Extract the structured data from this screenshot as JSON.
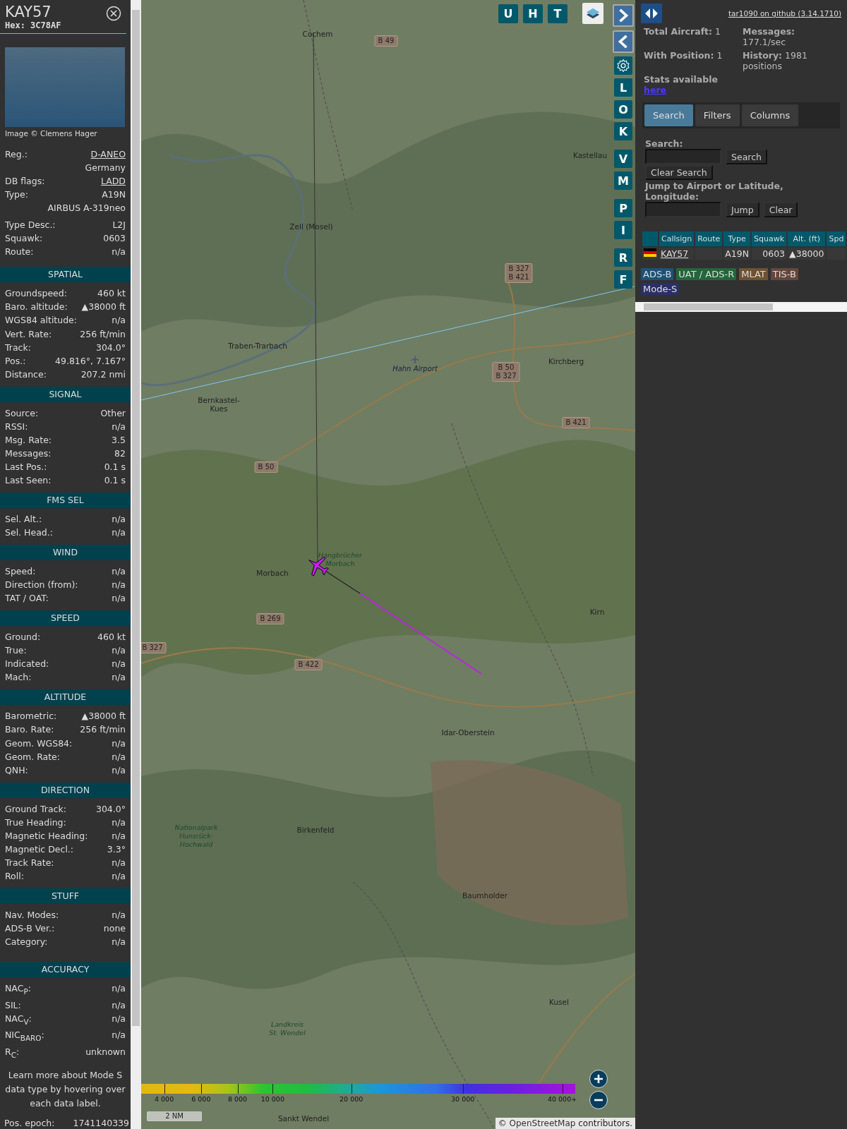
{
  "aircraft": {
    "callsign": "KAY57",
    "hex": "Hex: 3C78AF",
    "photo_credit": "Image © Clemens Hager",
    "details": [
      {
        "label": "Reg.:",
        "value": "D-ANEO",
        "kind": "link"
      },
      {
        "value": "Germany",
        "kind": "text"
      },
      {
        "label": "DB flags:",
        "value": "LADD",
        "kind": "link"
      },
      {
        "label": "Type:",
        "value": "A19N",
        "kind": "text"
      },
      {
        "value": "AIRBUS A-319neo",
        "kind": "text"
      },
      {
        "label": "Type Desc.:",
        "value": "L2J",
        "kind": "text"
      },
      {
        "label": "Squawk:",
        "value": "0603",
        "kind": "text"
      },
      {
        "label": "Route:",
        "value": "n/a",
        "kind": "text"
      }
    ],
    "sections": [
      {
        "title": "SPATIAL",
        "rows": [
          {
            "label": "Groundspeed:",
            "value": "460 kt"
          },
          {
            "label": "Baro. altitude:",
            "value": "▲38000 ft"
          },
          {
            "label": "WGS84 altitude:",
            "value": "n/a"
          },
          {
            "label": "Vert. Rate:",
            "value": "256 ft/min"
          },
          {
            "label": "Track:",
            "value": "304.0°"
          },
          {
            "label": "Pos.:",
            "value": "49.816°, 7.167°"
          },
          {
            "label": "Distance:",
            "value": "207.2 nmi"
          }
        ]
      },
      {
        "title": "SIGNAL",
        "rows": [
          {
            "label": "Source:",
            "value": "Other"
          },
          {
            "label": "RSSI:",
            "value": "n/a"
          },
          {
            "label": "Msg. Rate:",
            "value": "3.5"
          },
          {
            "label": "Messages:",
            "value": "82"
          },
          {
            "label": "Last Pos.:",
            "value": "0.1 s"
          },
          {
            "label": "Last Seen:",
            "value": "0.1 s"
          }
        ]
      },
      {
        "title": "FMS SEL",
        "rows": [
          {
            "label": "Sel. Alt.:",
            "value": "n/a"
          },
          {
            "label": "Sel. Head.:",
            "value": "n/a"
          }
        ]
      },
      {
        "title": "WIND",
        "rows": [
          {
            "label": "Speed:",
            "value": "n/a"
          },
          {
            "label": "Direction (from):",
            "value": "n/a"
          },
          {
            "label": "TAT / OAT:",
            "value": "n/a"
          }
        ]
      },
      {
        "title": "SPEED",
        "rows": [
          {
            "label": "Ground:",
            "value": "460 kt"
          },
          {
            "label": "True:",
            "value": "n/a"
          },
          {
            "label": "Indicated:",
            "value": "n/a"
          },
          {
            "label": "Mach:",
            "value": "n/a"
          }
        ]
      },
      {
        "title": "ALTITUDE",
        "rows": [
          {
            "label": "Barometric:",
            "value": "▲38000 ft"
          },
          {
            "label": "Baro. Rate:",
            "value": "256 ft/min"
          },
          {
            "label": "Geom. WGS84:",
            "value": "n/a"
          },
          {
            "label": "Geom. Rate:",
            "value": "n/a"
          },
          {
            "label": "QNH:",
            "value": "n/a"
          }
        ]
      },
      {
        "title": "DIRECTION",
        "rows": [
          {
            "label": "Ground Track:",
            "value": "304.0°"
          },
          {
            "label": "True Heading:",
            "value": "n/a"
          },
          {
            "label": "Magnetic Heading:",
            "value": "n/a"
          },
          {
            "label": "Magnetic Decl.:",
            "value": "3.3°"
          },
          {
            "label": "Track Rate:",
            "value": "n/a"
          },
          {
            "label": "Roll:",
            "value": "n/a"
          }
        ]
      },
      {
        "title": "STUFF",
        "rows": [
          {
            "label": "Nav. Modes:",
            "value": "n/a"
          },
          {
            "label": "ADS-B Ver.:",
            "value": "none"
          },
          {
            "label": "Category:",
            "value": "n/a"
          }
        ]
      },
      {
        "title": "ACCURACY",
        "rows": [
          {
            "label": "NAC$_{P}$:",
            "value": "n/a"
          },
          {
            "label": "SIL:",
            "value": "n/a"
          },
          {
            "label": "NAC$_{V}$:",
            "value": "n/a"
          },
          {
            "label": "NIC$_{BARO}$:",
            "value": "n/a"
          },
          {
            "label": "R$_{C}$:",
            "value": "unknown"
          }
        ]
      }
    ],
    "note": "Learn more about Mode S data type by hovering over each data label.",
    "epoch": {
      "label": "Pos. epoch:",
      "value": "1741140339"
    }
  },
  "map": {
    "top_buttons": [
      "U",
      "H",
      "T"
    ],
    "side_groups": [
      [
        "L",
        "O",
        "K"
      ],
      [
        "V",
        "M"
      ],
      [
        "P",
        "I"
      ],
      [
        "R",
        "F"
      ]
    ],
    "places": [
      {
        "name": "Cochem",
        "kind": "town"
      },
      {
        "name": "Kastellau",
        "kind": "town"
      },
      {
        "name": "Zell (Mosel)",
        "kind": "town"
      },
      {
        "name": "Traben-Trarbach",
        "kind": "town"
      },
      {
        "name": "Hahn Airport",
        "kind": "airport"
      },
      {
        "name": "Kirchberg",
        "kind": "town"
      },
      {
        "name": "Bernkastel-\nKues",
        "kind": "town"
      },
      {
        "name": "Hangbrücher\nMorbach",
        "kind": "park"
      },
      {
        "name": "Morbach",
        "kind": "town"
      },
      {
        "name": "Kirn",
        "kind": "town"
      },
      {
        "name": "Idar-Oberstein",
        "kind": "town"
      },
      {
        "name": "Nationalpark\nHunsrück-\nHochwald",
        "kind": "park"
      },
      {
        "name": "Birkenfeld",
        "kind": "town"
      },
      {
        "name": "Baumholder",
        "kind": "town"
      },
      {
        "name": "Kusel",
        "kind": "town"
      },
      {
        "name": "Landkreis\nSt. Wendel",
        "kind": "park"
      },
      {
        "name": "Sankt Wendel",
        "kind": "town"
      },
      {
        "name": "B 49",
        "kind": "road"
      },
      {
        "name": "B 327\nB 421",
        "kind": "road"
      },
      {
        "name": "B 50\nB 327",
        "kind": "road"
      },
      {
        "name": "B 421",
        "kind": "road"
      },
      {
        "name": "B 50",
        "kind": "road"
      },
      {
        "name": "B 269",
        "kind": "road"
      },
      {
        "name": "B 327",
        "kind": "road"
      },
      {
        "name": "B 422",
        "kind": "road"
      }
    ],
    "legend": [
      "4 000",
      "6 000",
      "8 000",
      "10 000",
      "20 000",
      "30 000",
      "40 000+"
    ],
    "scale": "2 NM",
    "attribution": {
      "prefix": "©",
      "link": "OpenStreetMap",
      "suffix": "contributors."
    }
  },
  "panel": {
    "github_link": "tar1090 on github (3.14.1710)",
    "stats": [
      {
        "label": "Total Aircraft:",
        "value": "1"
      },
      {
        "label": "Messages:",
        "value": "177.1/sec"
      },
      {
        "label": "With Position:",
        "value": "1"
      },
      {
        "label": "History:",
        "value": "1981 positions"
      }
    ],
    "stats_note": "Stats available",
    "stats_link": "here",
    "tabs": [
      {
        "label": "Search",
        "selected": true
      },
      {
        "label": "Filters",
        "selected": false
      },
      {
        "label": "Columns",
        "selected": false
      }
    ],
    "search_label": "Search:",
    "search_button": "Search",
    "clear_search_button": "Clear Search",
    "jump_label": "Jump to Airport or Latitude, Longitude:",
    "jump_button": "Jump",
    "clear_button": "Clear",
    "columns": [
      "Callsign",
      "Route",
      "Type",
      "Squawk",
      "Alt. (ft)",
      "Spd"
    ],
    "rows": [
      {
        "callsign": "KAY57",
        "type": "A19N",
        "squawk": "0603",
        "altitude": "▲38000"
      }
    ],
    "sources": [
      {
        "label": "ADS-B",
        "color": "#1d5275"
      },
      {
        "label": "UAT / ADS-R",
        "color": "#23663a"
      },
      {
        "label": "MLAT",
        "color": "#6e5232"
      },
      {
        "label": "TIS-B",
        "color": "#66463c"
      },
      {
        "label": "Mode-S",
        "color": "#2b2f68"
      }
    ]
  }
}
